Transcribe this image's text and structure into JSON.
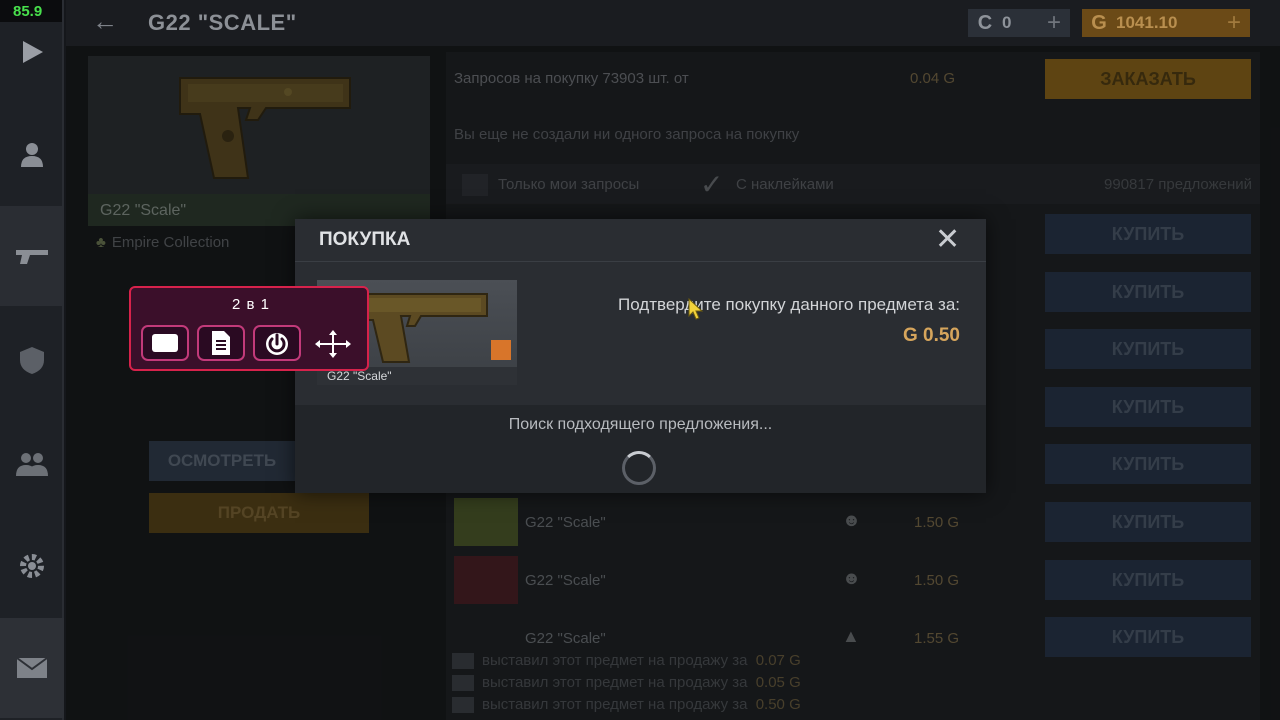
{
  "fps": "85.9",
  "header": {
    "title": "G22 \"SCALE\"",
    "currency_c": {
      "symbol": "C",
      "value": "0",
      "plus": "+"
    },
    "currency_g": {
      "symbol": "G",
      "value": "1041.10",
      "plus": "+"
    }
  },
  "item": {
    "name": "G22 \"Scale\"",
    "collection": "Empire Collection",
    "inspect_label": "ОСМОТРЕТЬ",
    "sell_label": "ПРОДАТЬ"
  },
  "requests": {
    "summary": "Запросов на покупку 73903 шт. от",
    "price": "0.04 G",
    "order_label": "ЗАКАЗАТЬ",
    "empty_text": "Вы еще не создали ни одного запроса на покупку"
  },
  "filters": {
    "only_mine": "Только мои запросы",
    "with_stickers": "С наклейками",
    "offers_count": "990817 предложений"
  },
  "offers": [
    {
      "name": "",
      "price": "",
      "buy": "КУПИТЬ"
    },
    {
      "name": "",
      "price": "",
      "buy": "КУПИТЬ"
    },
    {
      "name": "",
      "price": "",
      "buy": "КУПИТЬ"
    },
    {
      "name": "",
      "price": "",
      "buy": "КУПИТЬ"
    },
    {
      "name": "",
      "price": "",
      "buy": "КУПИТЬ"
    },
    {
      "name": "G22 \"Scale\"",
      "price": "1.50 G",
      "buy": "КУПИТЬ"
    },
    {
      "name": "G22 \"Scale\"",
      "price": "1.50 G",
      "buy": "КУПИТЬ"
    },
    {
      "name": "G22 \"Scale\"",
      "price": "1.55 G",
      "buy": "КУПИТЬ"
    }
  ],
  "history": [
    {
      "text": "выставил этот предмет на продажу за",
      "price": "0.07 G"
    },
    {
      "text": "выставил этот предмет на продажу за",
      "price": "0.05 G"
    },
    {
      "text": "выставил этот предмет на продажу за",
      "price": "0.50 G"
    }
  ],
  "modal": {
    "title": "ПОКУПКА",
    "close": "✕",
    "item_name": "G22 \"Scale\"",
    "confirm_text": "Подтвердите покупку данного предмета за:",
    "price": "G 0.50",
    "searching_text": "Поиск подходящего предложения..."
  },
  "widget": {
    "title": "2 в 1"
  }
}
